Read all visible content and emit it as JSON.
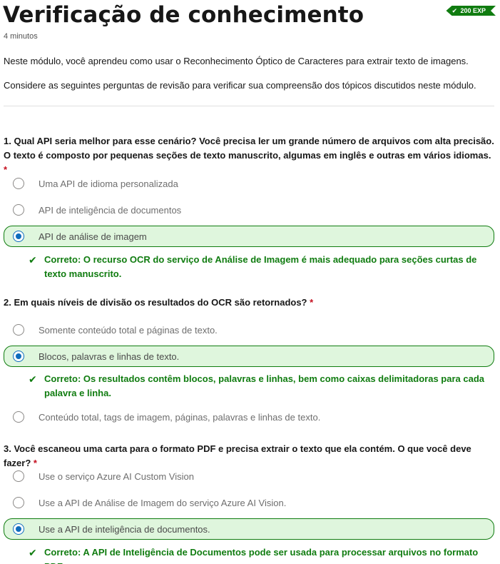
{
  "header": {
    "title": "Verificação de conhecimento",
    "duration": "4 minutos",
    "xp_badge": "200 EXP"
  },
  "intro": {
    "p1": "Neste módulo, você aprendeu como usar o Reconhecimento Óptico de Caracteres para extrair texto de imagens.",
    "p2": "Considere as seguintes perguntas de revisão para verificar sua compreensão dos tópicos discutidos neste módulo."
  },
  "questions": [
    {
      "text": "1. Qual API seria melhor para esse cenário? Você precisa ler um grande número de arquivos com alta precisão. O texto é composto por pequenas seções de texto manuscrito, algumas em inglês e outras em vários idiomas.",
      "required_mark": "*",
      "options": [
        {
          "label": "Uma API de idioma personalizada",
          "selected": false
        },
        {
          "label": "API de inteligência de documentos",
          "selected": false
        },
        {
          "label": "API de análise de imagem",
          "selected": true
        }
      ],
      "feedback": "Correto: O recurso OCR do serviço de Análise de Imagem é mais adequado para seções curtas de texto manuscrito."
    },
    {
      "text": "2. Em quais níveis de divisão os resultados do OCR são retornados?",
      "required_mark": "*",
      "options": [
        {
          "label": "Somente conteúdo total e páginas de texto.",
          "selected": false
        },
        {
          "label": "Blocos, palavras e linhas de texto.",
          "selected": true
        },
        {
          "label": "Conteúdo total, tags de imagem, páginas, palavras e linhas de texto.",
          "selected": false
        }
      ],
      "feedback": "Correto: Os resultados contêm blocos, palavras e linhas, bem como caixas delimitadoras para cada palavra e linha."
    },
    {
      "text": "3. Você escaneou uma carta para o formato PDF e precisa extrair o texto que ela contém. O que você deve fazer?",
      "required_mark": "*",
      "options": [
        {
          "label": "Use o serviço Azure AI Custom Vision",
          "selected": false
        },
        {
          "label": "Use a API de Análise de Imagem do serviço Azure AI Vision.",
          "selected": false
        },
        {
          "label": "Use a API de inteligência de documentos.",
          "selected": true
        }
      ],
      "feedback": "Correto: A API de Inteligência de Documentos pode ser usada para processar arquivos no formato PDF."
    }
  ],
  "colors": {
    "correct": "#107c10",
    "selected_bg": "#dff6dd",
    "radio_selected": "#0f6cbd",
    "required": "#c50f1f"
  },
  "icons": {
    "badge": "check-icon",
    "feedback": "check-icon"
  }
}
